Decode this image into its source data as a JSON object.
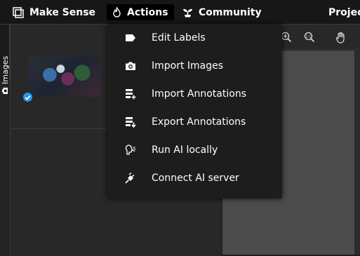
{
  "app": {
    "brand": "Make Sense"
  },
  "topbar": {
    "items": [
      {
        "label": "Actions",
        "icon": "fire-icon"
      },
      {
        "label": "Community",
        "icon": "plant-icon"
      },
      {
        "label": "Project"
      }
    ]
  },
  "sidebar": {
    "tab_label": "Images",
    "tab_icon": "camera-icon"
  },
  "images_panel": {
    "thumbnail_status": "checked"
  },
  "toolbar": {
    "buttons": [
      "zoom-in-icon",
      "zoom-fit-icon",
      "hand-icon"
    ]
  },
  "actions_menu": {
    "items": [
      {
        "label": "Edit Labels",
        "icon": "label-tag-icon"
      },
      {
        "label": "Import Images",
        "icon": "camera-icon"
      },
      {
        "label": "Import Annotations",
        "icon": "list-add-icon"
      },
      {
        "label": "Export Annotations",
        "icon": "list-export-icon"
      },
      {
        "label": "Run AI locally",
        "icon": "ai-local-icon"
      },
      {
        "label": "Connect AI server",
        "icon": "plug-icon"
      }
    ]
  },
  "colors": {
    "topbar_bg": "#171717",
    "panel_bg": "#282828",
    "menu_bg": "#1d1d1d",
    "accent": "#2196f3"
  }
}
